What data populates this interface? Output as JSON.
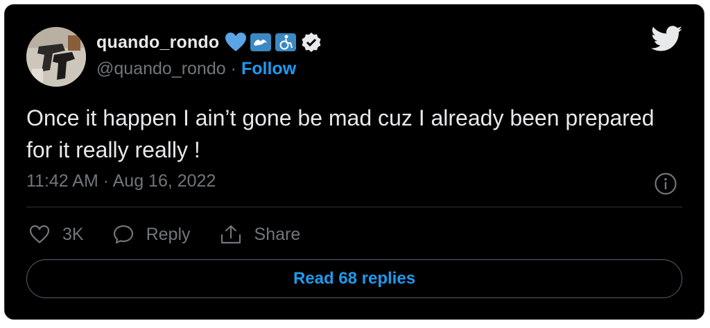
{
  "user": {
    "display_name": "quando_rondo",
    "handle": "@quando_rondo",
    "separator": "·",
    "follow_label": "Follow",
    "badges": [
      "blue-heart-icon",
      "wave-icon",
      "wheelchair-icon",
      "verified-icon"
    ]
  },
  "tweet": {
    "text": "Once it happen I ain’t gone be mad cuz I already been prepared for it really really !",
    "timestamp": "11:42 AM · Aug 16, 2022"
  },
  "actions": {
    "like_count": "3K",
    "reply_label": "Reply",
    "share_label": "Share"
  },
  "footer": {
    "read_replies_label": "Read 68 replies"
  },
  "colors": {
    "background": "#000000",
    "text": "#e7e9ea",
    "secondary": "#71767b",
    "accent": "#1d9bf0",
    "border": "#2f3336"
  }
}
